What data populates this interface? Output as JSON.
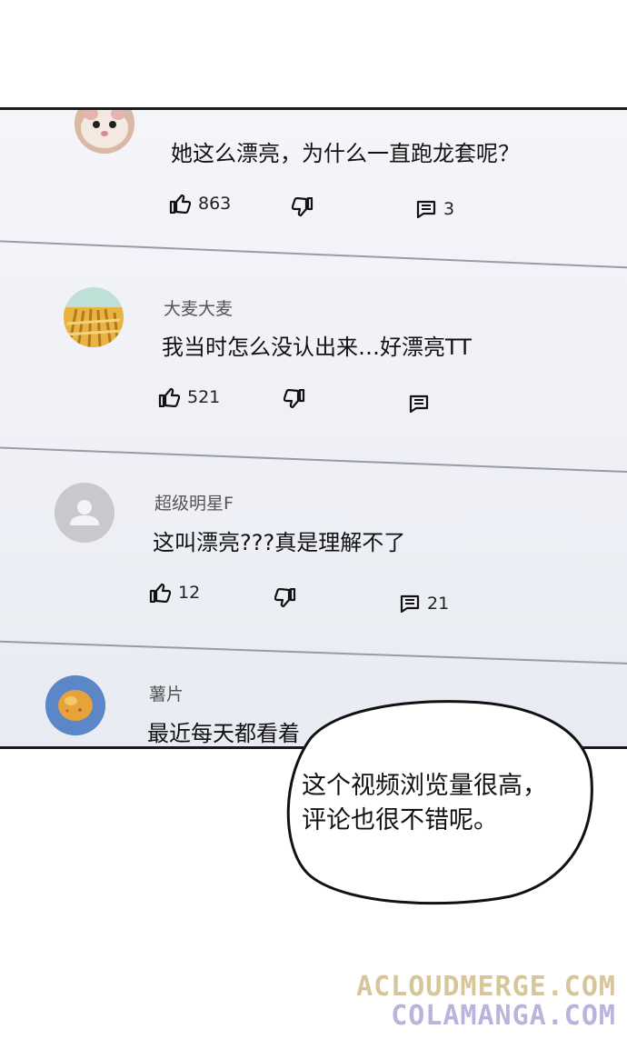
{
  "comments": [
    {
      "avatar": "hamster-avatar",
      "username": "",
      "text": "她这么漂亮，为什么一直跑龙套呢？",
      "likes": "863",
      "replies": "3"
    },
    {
      "avatar": "wheat-field-avatar",
      "username": "大麦大麦",
      "text": "我当时怎么没认出来…好漂亮TT",
      "likes": "521",
      "replies": ""
    },
    {
      "avatar": "default-user-avatar",
      "username": "超级明星F",
      "text": "这叫漂亮???真是理解不了",
      "likes": "12",
      "replies": "21"
    },
    {
      "avatar": "potato-chip-avatar",
      "username": "薯片",
      "text": "最近每天都看着",
      "likes": "",
      "replies": ""
    }
  ],
  "bubble": {
    "line1": "这个视频浏览量很高，",
    "line2": "评论也很不错呢。"
  },
  "watermark": {
    "line1": "ACLOUDMERGE.COM",
    "line2": "COLAMANGA.COM"
  },
  "icons": {
    "like": "thumbs-up-icon",
    "dislike": "thumbs-down-icon",
    "reply": "comment-icon"
  },
  "colors": {
    "panel_bg": "#eef0f6",
    "watermark_top": "#d8c89a",
    "watermark_bottom": "#b9b6e0"
  }
}
